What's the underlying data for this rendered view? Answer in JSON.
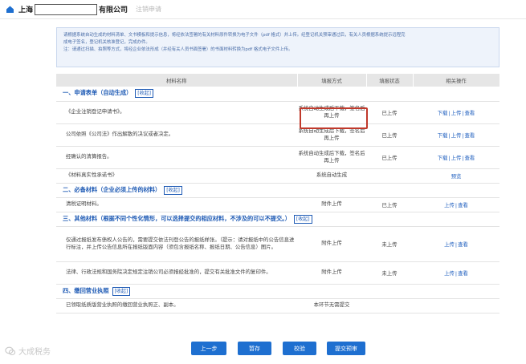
{
  "header": {
    "company_prefix": "上海",
    "company_suffix": "有限公司",
    "breadcrumb": "注销申请"
  },
  "notice": {
    "line1": "请根据系统自动生成的材料清单、文书模板和提示信息，将经依法签署的有关材料原件转换为电子文件（pdf 格式）并上传。经登记机关预审通过后，有关人员根据系统提示远程完",
    "line2": "成电子签名，登记机关核准登记，完成办件。",
    "line3": "注：请通过扫描、拍照等方式，将经企业依法形成（并经有关人员书面签署）的书面材料转换为pdf 格式电子文件上传。"
  },
  "table": {
    "headers": [
      "材料名称",
      "填报方式",
      "填报状态",
      "相关操作"
    ],
    "sections": [
      {
        "title": "一、申请表单（自动生成）",
        "collapse": "[收起]",
        "rows": [
          {
            "name": "《企业注销登记申请书》。",
            "method": "系统自动生成后下载，签名后再上传",
            "status": "已上传",
            "ops": [
              "下载",
              "上传",
              "查看"
            ]
          },
          {
            "name": "公司依照《公司法》作出解散的决议或者决定。",
            "method": "系统自动生成后下载，签名后再上传",
            "status": "已上传",
            "ops": [
              "下载",
              "上传",
              "查看"
            ]
          },
          {
            "name": "经确认的清算报告。",
            "method": "系统自动生成后下载，签名后再上传",
            "status": "已上传",
            "ops": [
              "下载",
              "上传",
              "查看"
            ]
          },
          {
            "name": "《材料真实性承诺书》",
            "method": "系统自动生成",
            "status": "",
            "ops": [
              "预览"
            ]
          }
        ]
      },
      {
        "title": "二、必备材料（企业必须上传的材料）",
        "collapse": "[收起]",
        "rows": [
          {
            "name": "清税证明材料。",
            "method": "附件上传",
            "status": "已上传",
            "ops": [
              "上传",
              "查看"
            ]
          }
        ]
      },
      {
        "title": "三、其他材料（根据不同个性化情形，可以选择提交的相应材料，不涉及的可以不提交。）",
        "collapse": "[收起]",
        "rows": [
          {
            "name": "仅通过报纸发布债权人公告的，需要提交依法刊登公告的报纸样张。（提示：请对报纸中的公告信息进行标注，并上传公告信息所在报纸版面内容（须包含报纸名称、报纸日期、公告信息）图片。",
            "method": "附件上传",
            "status": "未上传",
            "ops": [
              "上传",
              "查看"
            ]
          },
          {
            "name": "法律、行政法规和国务院决定规定注销公司必须报经批准的，提交有关批准文件的复印件。",
            "method": "附件上传",
            "status": "未上传",
            "ops": [
              "上传",
              "查看"
            ]
          }
        ]
      },
      {
        "title": "四、缴回营业执照",
        "collapse": "[收起]",
        "rows": [
          {
            "name": "已领取纸质版营业执照的缴回营业执照正、副本。",
            "method": "本环节无需提交",
            "status": "",
            "ops": []
          }
        ]
      }
    ]
  },
  "buttons": {
    "prev": "上一步",
    "save": "暂存",
    "validate": "校验",
    "submit": "提交预审"
  },
  "watermark": "大成税务",
  "colors": {
    "primary": "#1e6fd0",
    "section_title": "#1f5bb5",
    "highlight": "#c0392b",
    "notice_bg": "#eef3fb"
  }
}
